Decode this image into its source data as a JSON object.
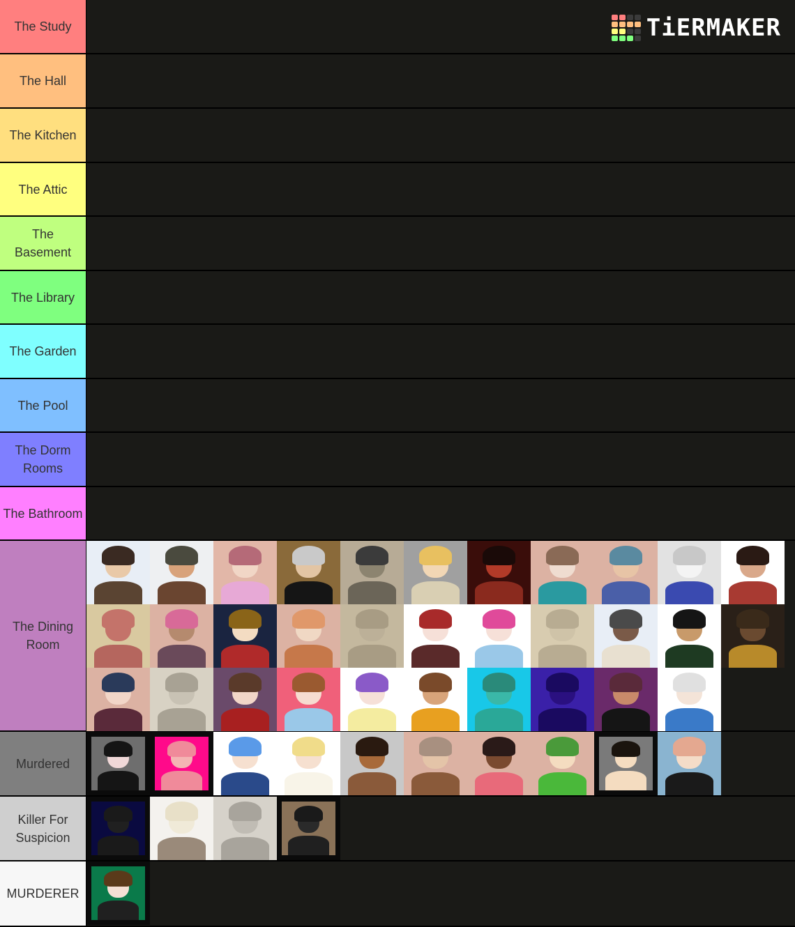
{
  "app": {
    "logo_text": "TiERMAKER",
    "logo_grid_colors": [
      "#ff7f7f",
      "#ff7f7f",
      "#3b3b3b",
      "#3b3b3b",
      "#ffbf7f",
      "#ffbf7f",
      "#ffbf7f",
      "#ffbf7f",
      "#ffff7f",
      "#ffff7f",
      "#3b3b3b",
      "#3b3b3b",
      "#7fff7f",
      "#7fff7f",
      "#7fff7f",
      "#3b3b3b"
    ]
  },
  "tiers": [
    {
      "label": "The Study",
      "color": "#ff7f7f",
      "items": []
    },
    {
      "label": "The Hall",
      "color": "#ffbf7f",
      "items": []
    },
    {
      "label": "The Kitchen",
      "color": "#ffdf7f",
      "items": []
    },
    {
      "label": "The Attic",
      "color": "#ffff7f",
      "items": []
    },
    {
      "label": "The Basement",
      "color": "#bfff7f",
      "items": []
    },
    {
      "label": "The Library",
      "color": "#7fff7f",
      "items": []
    },
    {
      "label": "The Garden",
      "color": "#7fffff",
      "items": []
    },
    {
      "label": "The Pool",
      "color": "#7fbfff",
      "items": []
    },
    {
      "label": "The Dorm Rooms",
      "color": "#7f7fff",
      "items": []
    },
    {
      "label": "The Bathroom",
      "color": "#ff7fff",
      "items": []
    },
    {
      "label": "The Dining Room",
      "color": "#bf7fbf",
      "items": [
        {
          "name": "masked clawed character",
          "bg": "#e8eef6",
          "hair": "#3a2a22",
          "skin": "#e9c9a8",
          "outfit": "#5a4432"
        },
        {
          "name": "masked man in beanie",
          "bg": "#eef0f2",
          "hair": "#4a4a3e",
          "skin": "#d8a27a",
          "outfit": "#6a4530"
        },
        {
          "name": "pink-haired archer",
          "bg": "#e2b7a8",
          "hair": "#b56a78",
          "skin": "#f1d6c6",
          "outfit": "#e7a9d6"
        },
        {
          "name": "silver-haired man",
          "bg": "#8a6a3a",
          "hair": "#c9c9c9",
          "skin": "#e3c5a4",
          "outfit": "#151515"
        },
        {
          "name": "sketched ogre",
          "bg": "#b7ab96",
          "hair": "#3b3b3b",
          "skin": "#8c8470",
          "outfit": "#6b6558"
        },
        {
          "name": "blonde masked character",
          "bg": "#a0a0a0",
          "hair": "#e8c060",
          "skin": "#f2d7b5",
          "outfit": "#d9cfb3"
        },
        {
          "name": "red demon",
          "bg": "#3a0d0a",
          "hair": "#1a0a08",
          "skin": "#b23a28",
          "outfit": "#8a2a1e"
        },
        {
          "name": "Shroom",
          "bg": "#dcb2a3",
          "hair": "#8a6a56",
          "skin": "#efdcd0",
          "outfit": "#2a9aa0"
        },
        {
          "name": "blue-haired fighter",
          "bg": "#dcb2a3",
          "hair": "#5a8aa0",
          "skin": "#e7c4a6",
          "outfit": "#4a5fa8"
        },
        {
          "name": "sketched brawler",
          "bg": "#e2e2e2",
          "hair": "#c8c8c8",
          "skin": "#f4f4f4",
          "outfit": "#3a4ab0"
        },
        {
          "name": "long-haired woman in red",
          "bg": "#ffffff",
          "hair": "#2a1a14",
          "skin": "#d9a88a",
          "outfit": "#a83a32"
        },
        {
          "name": "box creature",
          "bg": "#d9c9a0",
          "hair": "#c4736a",
          "skin": "#c4736a",
          "outfit": "#b5665e"
        },
        {
          "name": "pink-haired masked woman",
          "bg": "#dcb2a3",
          "hair": "#d86a98",
          "skin": "#b58a6e",
          "outfit": "#6a4a5a"
        },
        {
          "name": "glasses girl",
          "bg": "#1a2440",
          "hair": "#8a6418",
          "skin": "#f3dcc2",
          "outfit": "#b02a2a"
        },
        {
          "name": "mushroom hat character",
          "bg": "#dcb2a3",
          "hair": "#e0986a",
          "skin": "#f0d8c4",
          "outfit": "#c6784a"
        },
        {
          "name": "faint sketch",
          "bg": "#c4b89e",
          "hair": "#a89c84",
          "skin": "#bcb098",
          "outfit": "#a89c84"
        },
        {
          "name": "red-haired woman",
          "bg": "#ffffff",
          "hair": "#a82a2a",
          "skin": "#f6e0d8",
          "outfit": "#5a2a2a"
        },
        {
          "name": "pink-haired nurse",
          "bg": "#ffffff",
          "hair": "#e04a9a",
          "skin": "#f6e0d8",
          "outfit": "#9ac8e8"
        },
        {
          "name": "sketched knight",
          "bg": "#d8ccb0",
          "hair": "#b8ac92",
          "skin": "#cfc3a8",
          "outfit": "#b8ac92"
        },
        {
          "name": "horned grinning creature",
          "bg": "#e8eef6",
          "hair": "#4a4a4a",
          "skin": "#7a5a48",
          "outfit": "#e8e0d0"
        },
        {
          "name": "masked man in green",
          "bg": "#ffffff",
          "hair": "#151515",
          "skin": "#c89a6a",
          "outfit": "#1e3a22"
        },
        {
          "name": "golden-eyed woman",
          "bg": "#2a2018",
          "hair": "#3a2a1a",
          "skin": "#6a4a30",
          "outfit": "#b88a2a"
        },
        {
          "name": "winged gargoyle woman",
          "bg": "#dcb2a3",
          "hair": "#2a3a5a",
          "skin": "#f2d6c8",
          "outfit": "#5a2a3a"
        },
        {
          "name": "pencil sketch warrior",
          "bg": "#d8d2c4",
          "hair": "#a8a294",
          "skin": "#c8c2b4",
          "outfit": "#a8a294"
        },
        {
          "name": "woman with bat",
          "bg": "#6a4a6a",
          "hair": "#5a3a2a",
          "skin": "#f2d6c8",
          "outfit": "#a82020"
        },
        {
          "name": "cat-eared girl",
          "bg": "#f0607a",
          "hair": "#9a5a30",
          "skin": "#f6dcd0",
          "outfit": "#9ac8e8"
        },
        {
          "name": "purple-haired girl",
          "bg": "#ffffff",
          "hair": "#8a5ac8",
          "skin": "#f6e0d8",
          "outfit": "#f4eca0"
        },
        {
          "name": "curly-haired smiling man",
          "bg": "#ffffff",
          "hair": "#7a4a2a",
          "skin": "#d8a47a",
          "outfit": "#e8a020"
        },
        {
          "name": "straw hat figure",
          "bg": "#18c8e8",
          "hair": "#2a8a7a",
          "skin": "#3ab8a8",
          "outfit": "#2aa898"
        },
        {
          "name": "shadow muscle figure",
          "bg": "#3a20a8",
          "hair": "#1a0a60",
          "skin": "#2a1080",
          "outfit": "#1a0a60"
        },
        {
          "name": "masked woman with earrings",
          "bg": "#6a2a6a",
          "hair": "#5a2a3a",
          "skin": "#c88a6a",
          "outfit": "#151515"
        },
        {
          "name": "white-haired man",
          "bg": "#ffffff",
          "hair": "#e0e0e0",
          "skin": "#f4e4d8",
          "outfit": "#3a7ac8"
        }
      ]
    },
    {
      "label": "Murdered",
      "color": "#7f7f7f",
      "items": [
        {
          "name": "boy in black hoodie",
          "bg": "#6e6e6e",
          "hair": "#151515",
          "skin": "#f0d8d8",
          "outfit": "#151515",
          "framed": true
        },
        {
          "name": "pink hooded creature",
          "bg": "#ff0a8a",
          "hair": "#f08a9a",
          "skin": "#f4b4b4",
          "outfit": "#f08a9a",
          "framed": true
        },
        {
          "name": "blue-haired boy",
          "bg": "#ffffff",
          "hair": "#5a9ae8",
          "skin": "#f6e0d0",
          "outfit": "#2a4a8a"
        },
        {
          "name": "blonde man in white",
          "bg": "#ffffff",
          "hair": "#f0dc8a",
          "skin": "#f6e0d0",
          "outfit": "#f8f4e8"
        },
        {
          "name": "dark-haired woman",
          "bg": "#c8c8c8",
          "hair": "#2a1a10",
          "skin": "#a86a3a",
          "outfit": "#8a5a3a"
        },
        {
          "name": "praying man",
          "bg": "#dcb2a3",
          "hair": "#a89080",
          "skin": "#e4c4a8",
          "outfit": "#8a5a3a"
        },
        {
          "name": "woman in bucket hat",
          "bg": "#dcb2a3",
          "hair": "#2a1a18",
          "skin": "#7a4a30",
          "outfit": "#e86a7a"
        },
        {
          "name": "soldier in green",
          "bg": "#dcb2a3",
          "hair": "#4a9a3a",
          "skin": "#f4dcc0",
          "outfit": "#4ab83a"
        },
        {
          "name": "shirtless boy",
          "bg": "#7a7a7a",
          "hair": "#1a140e",
          "skin": "#f4dcc0",
          "outfit": "#f4dcc0",
          "framed": true
        },
        {
          "name": "pink-haired fighter",
          "bg": "#8ab4d0",
          "hair": "#e4a890",
          "skin": "#f4dcc8",
          "outfit": "#1a1a1a"
        }
      ]
    },
    {
      "label": "Killer For Suspicion",
      "color": "#cfcfcf",
      "items": [
        {
          "name": "black armored figure",
          "bg": "#0a0a40",
          "hair": "#1a1a1a",
          "skin": "#202020",
          "outfit": "#1a1a1a",
          "framed": true
        },
        {
          "name": "white beast",
          "bg": "#f4f2ee",
          "hair": "#e8e0c8",
          "skin": "#f0ead8",
          "outfit": "#9a8a7a"
        },
        {
          "name": "horned sketch demon",
          "bg": "#d6d2ca",
          "hair": "#a8a49c",
          "skin": "#c0bcb4",
          "outfit": "#a8a49c"
        },
        {
          "name": "man in red-band hat",
          "bg": "#8a7258",
          "hair": "#1a1a1a",
          "skin": "#2a2a2a",
          "outfit": "#202020",
          "framed": true
        }
      ]
    },
    {
      "label": "MURDERER",
      "color": "#f7f7f7",
      "items": [
        {
          "name": "brown-haired boy in jacket",
          "bg": "#0a7a4a",
          "hair": "#5a3a1a",
          "skin": "#f4e0d4",
          "outfit": "#202020",
          "framed": true
        }
      ]
    }
  ]
}
